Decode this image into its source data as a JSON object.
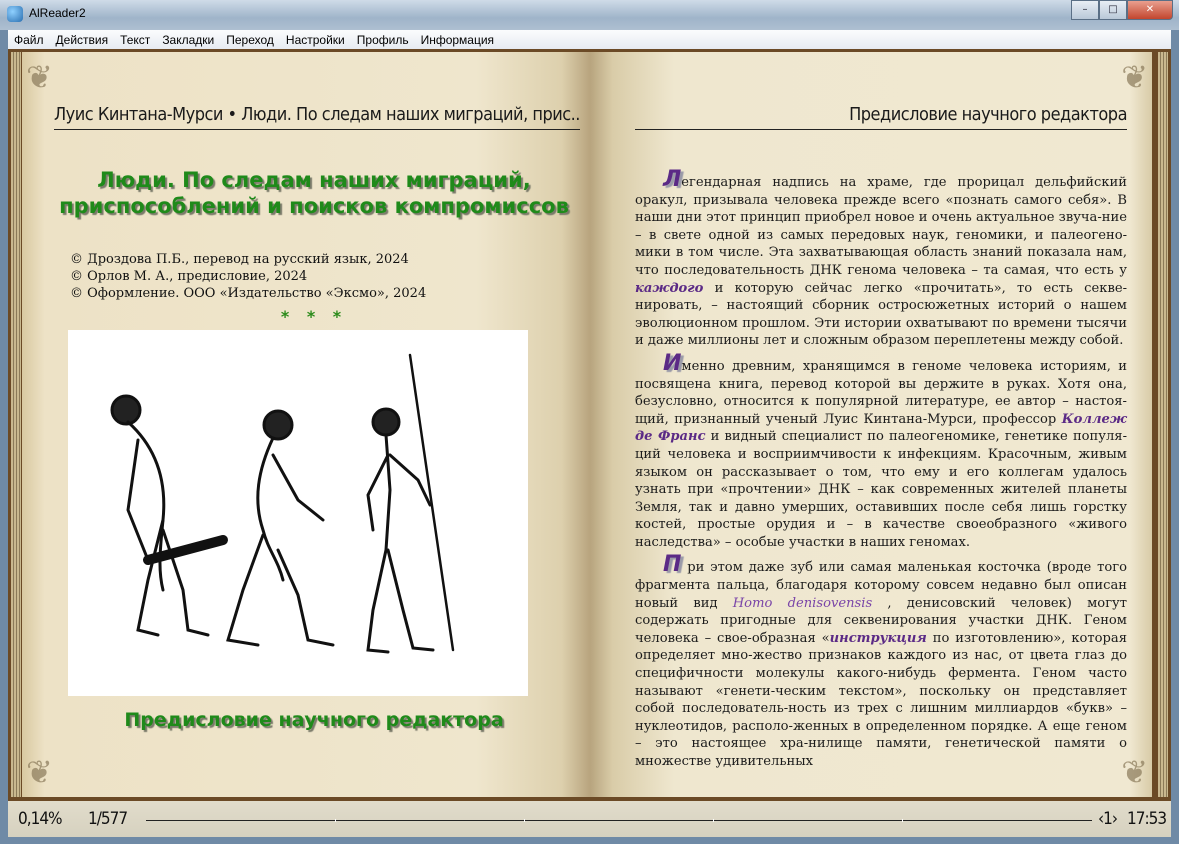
{
  "window": {
    "title": "AlReader2",
    "controls": [
      "minimize",
      "maximize",
      "close"
    ]
  },
  "menu": [
    "Файл",
    "Действия",
    "Текст",
    "Закладки",
    "Переход",
    "Настройки",
    "Профиль",
    "Информация"
  ],
  "left_page": {
    "header": "Луис Кинтана-Мурси  • Люди. По следам наших миграций, прис..",
    "title": "Люди. По следам наших миграций, приспособлений и поисков компромиссов",
    "copyrights": [
      "© Дроздова П.Б., перевод на русский язык, 2024",
      "© Орлов М. А., предисловие, 2024",
      "© Оформление. ООО «Издательство «Эксмо», 2024"
    ],
    "separator": "* * *",
    "illustration": "human-evolution-drawing",
    "section_title": "Предисловие научного редактора"
  },
  "right_page": {
    "header": "Предисловие научного редактора",
    "paragraphs": [
      {
        "drop": "Л",
        "segments": [
          {
            "t": "егендарная надпись на храме, где прорицал дельфийский оракул, призывала человека прежде всего «познать самого себя». В наши дни этот принцип приобрел новое и очень актуальное звуча-ние – в свете одной из самых передовых наук, геномики, и палеогено-мики в том числе. Эта захватывающая область знаний показала нам, что последовательность ДНК генома человека – та самая, что есть у "
          },
          {
            "t": "каждого",
            "s": "em"
          },
          {
            "t": "  и которую сейчас легко «прочитать», то есть секве-нировать, – настоящий сборник остросюжетных историй о нашем эволюционном прошлом. Эти истории охватывают по времени тысячи и даже миллионы лет и сложным образом переплетены между собой."
          }
        ]
      },
      {
        "drop": "И",
        "segments": [
          {
            "t": "менно древним, хранящимся в геноме человека историям, и посвящена книга, перевод которой вы держите в руках. Хотя она, безусловно, относится к популярной литературе, ее автор – настоя-щий, признанный ученый Луис Кинтана-Мурси, профессор "
          },
          {
            "t": "Коллеж де Франс",
            "s": "em"
          },
          {
            "t": "  и видный специалист по палеогеномике, генетике популя-ций человека и восприимчивости к инфекциям. Красочным, живым языком он рассказывает о том, что ему и его коллегам удалось узнать при «прочтении» ДНК – как современных жителей планеты Земля, так и давно умерших, оставивших после себя лишь горстку костей, простые орудия и – в качестве своеобразного «живого наследства» – особые участки в наших геномах."
          }
        ]
      },
      {
        "drop": "П",
        "segments": [
          {
            "t": " ри этом даже зуб или самая маленькая косточка (вроде того фрагмента пальца, благодаря которому совсем недавно был описан новый вид "
          },
          {
            "t": "Homo denisovensis",
            "s": "lat"
          },
          {
            "t": " , денисовский человек) могут содержать пригодные для секвенирования участки ДНК. Геном человека – свое-образная «"
          },
          {
            "t": "инструкция",
            "s": "em"
          },
          {
            "t": "  по изготовлению», которая определяет мно-жество признаков каждого из нас, от цвета глаз до специфичности молекулы какого-нибудь фермента. Геном часто называют «генети-ческим текстом», поскольку он представляет собой последователь-ность из трех с лишним миллиардов «букв» – нуклеотидов, располо-женных в определенном порядке. А еще геном – это настоящее хра-нилище памяти, генетической памяти о множестве удивительных"
          }
        ]
      }
    ]
  },
  "status": {
    "percent": "0,14%",
    "page": "1/577",
    "progress_fraction": 0.0014,
    "chapter": "‹1›",
    "clock": "17:53"
  },
  "colors": {
    "title_green": "#1f8a1a",
    "accent_purple": "#5b2a86",
    "paper": "#efe6cd"
  }
}
